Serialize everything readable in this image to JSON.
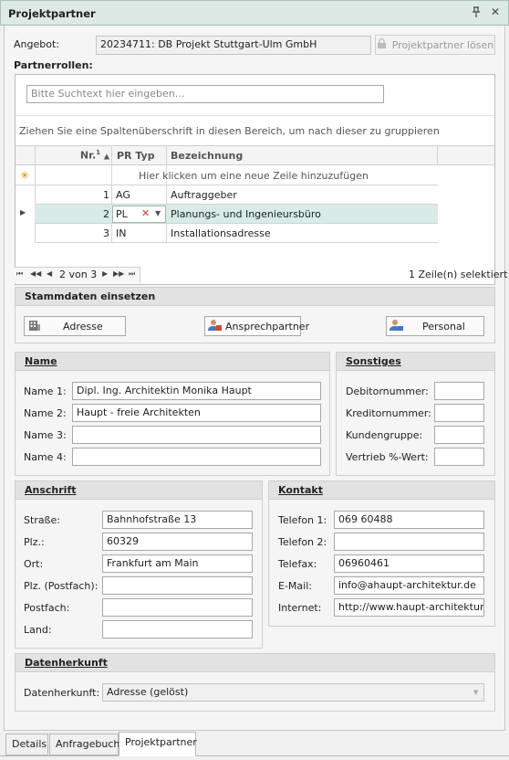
{
  "window": {
    "title": "Projektpartner"
  },
  "angebot": {
    "label": "Angebot:",
    "value": "20234711: DB Projekt Stuttgart-Ulm GmbH",
    "release_button": "Projektpartner lösen"
  },
  "partnerrollen": {
    "label": "Partnerrollen:",
    "search_placeholder": "Bitte Suchtext hier eingeben...",
    "group_hint": "Ziehen Sie eine Spaltenüberschrift in diesen Bereich, um nach dieser zu gruppieren",
    "columns": {
      "nr": "Nr.",
      "sort_index": "1",
      "typ": "PR Typ",
      "bez": "Bezeichnung"
    },
    "new_row_hint": "Hier klicken um eine neue Zeile hinzuzufügen",
    "rows": [
      {
        "nr": "1",
        "typ": "AG",
        "bez": "Auftraggeber"
      },
      {
        "nr": "2",
        "typ": "PL",
        "bez": "Planungs- und Ingenieursbüro"
      },
      {
        "nr": "3",
        "typ": "IN",
        "bez": "Installationsadresse"
      }
    ],
    "pager": "2 von 3",
    "selected": "1 Zeile(n) selektiert"
  },
  "stammdaten": {
    "title": "Stammdaten einsetzen",
    "adresse": "Adresse",
    "ansprechpartner": "Ansprechpartner",
    "personal": "Personal"
  },
  "name": {
    "title": "Name",
    "name1_label": "Name 1:",
    "name1": "Dipl. Ing. Architektin Monika Haupt",
    "name2_label": "Name 2:",
    "name2": "Haupt - freie Architekten",
    "name3_label": "Name 3:",
    "name3": "",
    "name4_label": "Name 4:",
    "name4": ""
  },
  "sonstiges": {
    "title": "Sonstiges",
    "debitor": "Debitornummer:",
    "kreditor": "Kreditornummer:",
    "kundengruppe": "Kundengruppe:",
    "vertrieb": "Vertrieb %-Wert:"
  },
  "anschrift": {
    "title": "Anschrift",
    "strasse_label": "Straße:",
    "strasse": "Bahnhofstraße 13",
    "plz_label": "Plz.:",
    "plz": "60329",
    "ort_label": "Ort:",
    "ort": "Frankfurt am Main",
    "plz_postfach_label": "Plz. (Postfach):",
    "postfach_label": "Postfach:",
    "land_label": "Land:"
  },
  "kontakt": {
    "title": "Kontakt",
    "tel1_label": "Telefon 1:",
    "tel1": "069 60488",
    "tel2_label": "Telefon 2:",
    "tel2": "",
    "fax_label": "Telefax:",
    "fax": "06960461",
    "email_label": "E-Mail:",
    "email": "info@ahaupt-architektur.de",
    "internet_label": "Internet:",
    "internet": "http://www.haupt-architektur.de"
  },
  "datenherkunft": {
    "title": "Datenherkunft",
    "label": "Datenherkunft:",
    "value": "Adresse (gelöst)"
  },
  "tabs": [
    "Details",
    "Anfragebuch",
    "Projektpartner"
  ],
  "colors": {
    "accent": "#dce9e5",
    "selected_row": "#d8ebe6",
    "delete_x": "#e03030"
  }
}
